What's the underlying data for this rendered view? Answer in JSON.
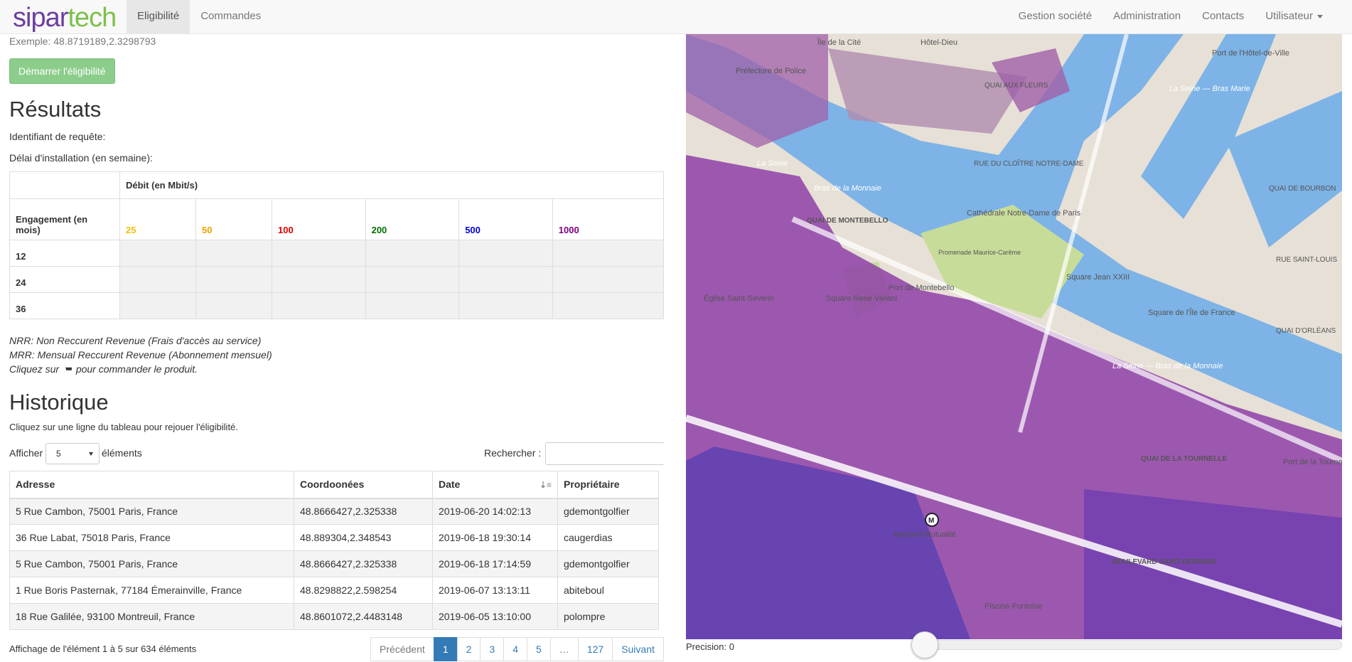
{
  "nav": {
    "brand_a": "sipar",
    "brand_b": "tech",
    "left": [
      "Eligibilité",
      "Commandes"
    ],
    "right": [
      "Gestion société",
      "Administration",
      "Contacts",
      "Utilisateur"
    ]
  },
  "form": {
    "example": "Exemple: 48.8719189,2.3298793",
    "start_button": "Démarrer l'éligibilité"
  },
  "results": {
    "title": "Résultats",
    "request_id_label": "Identifiant de requête:",
    "delay_label": "Délai d'installation (en semaine):",
    "debit_header": "Débit (en Mbit/s)",
    "engagement_header": "Engagement (en mois)",
    "speeds": [
      {
        "v": "25",
        "c": "#f0c000"
      },
      {
        "v": "50",
        "c": "#f0a000"
      },
      {
        "v": "100",
        "c": "#e00000"
      },
      {
        "v": "200",
        "c": "#007000"
      },
      {
        "v": "500",
        "c": "#0000dd"
      },
      {
        "v": "1000",
        "c": "#800080"
      }
    ],
    "durations": [
      "12",
      "24",
      "36"
    ]
  },
  "notes": {
    "nrr": "NRR: Non Reccurent Revenue (Frais d'accès au service)",
    "mrr": "MRR: Mensual Reccurent Revenue (Abonnement mensuel)",
    "cart_pre": "Cliquez sur",
    "cart_post": "pour commander le produit."
  },
  "history": {
    "title": "Historique",
    "hint": "Cliquez sur une ligne du tableau pour rejouer l'éligibilité.",
    "show_label": "Afficher",
    "show_value": "5",
    "show_suffix": "éléments",
    "search_label": "Rechercher :",
    "columns": [
      "Adresse",
      "Coordoonées",
      "Date",
      "Propriétaire"
    ],
    "rows": [
      [
        "5 Rue Cambon, 75001 Paris, France",
        "48.8666427,2.325338",
        "2019-06-20 14:02:13",
        "gdemontgolfier"
      ],
      [
        "36 Rue Labat, 75018 Paris, France",
        "48.889304,2.348543",
        "2019-06-18 19:30:14",
        "caugerdias"
      ],
      [
        "5 Rue Cambon, 75001 Paris, France",
        "48.8666427,2.325338",
        "2019-06-18 17:14:59",
        "gdemontgolfier"
      ],
      [
        "1 Rue Boris Pasternak, 77184 Émerainville, France",
        "48.8298822,2.598254",
        "2019-06-07 13:13:11",
        "abiteboul"
      ],
      [
        "18 Rue Galilée, 93100 Montreuil, France",
        "48.8601072,2.4483148",
        "2019-06-05 13:10:00",
        "polompre"
      ]
    ],
    "info": "Affichage de l'élément 1 à 5 sur 634 éléments",
    "pagination": [
      "Précédent",
      "1",
      "2",
      "3",
      "4",
      "5",
      "…",
      "127",
      "Suivant"
    ]
  },
  "map": {
    "precision_label": "Precision: 0",
    "precision_value": 0,
    "labels": [
      "Île de la Cité",
      "Hôtel-Dieu",
      "Préfecture de Police",
      "Port de l'Hôtel-de-Ville",
      "La Seine — Bras Marie",
      "QUAI AUX FLEURS",
      "RUE DU CLOÎTRE NOTRE-DAME",
      "Cathédrale Notre-Dame de Paris",
      "QUAI DE MONTEBELLO",
      "La Seine",
      "Bras de la Monnaie",
      "Square René Viviani",
      "Église Saint-Séverin",
      "Port de Montebello",
      "Promenade Maurice-Carême",
      "Square Jean XXIII",
      "Square de l'Île de France",
      "La Seine — Bras de la Monnaie",
      "QUAI DE LA TOURNELLE",
      "Port de la Tournelle",
      "BOULEVARD SAINT-GERMAIN",
      "Maubert Mutualité",
      "Piscine Pontoise",
      "QUAI DE BOURBON",
      "RUE SAINT-LOUIS",
      "QUAI D'ORLÉANS"
    ]
  }
}
